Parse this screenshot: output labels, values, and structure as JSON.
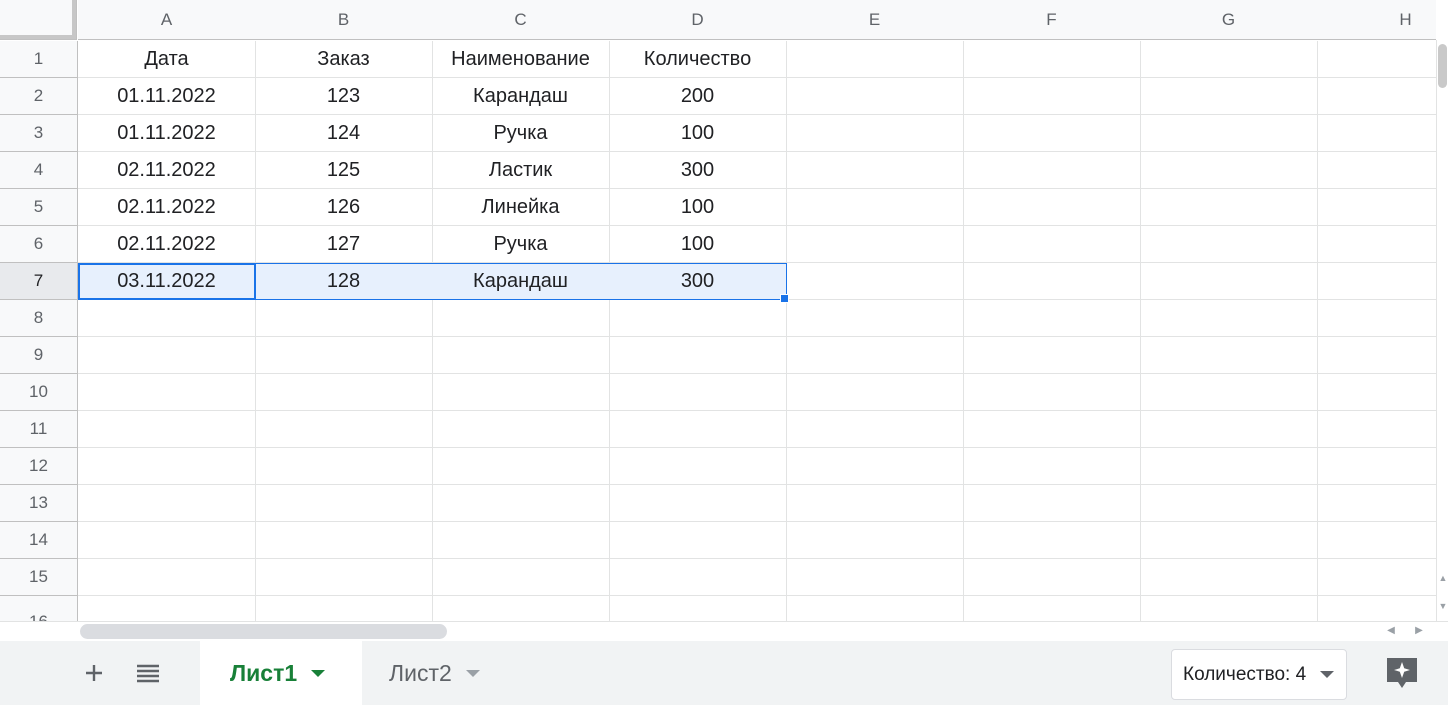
{
  "columns": [
    "A",
    "B",
    "C",
    "D",
    "E",
    "F",
    "G",
    "H"
  ],
  "rows": [
    "1",
    "2",
    "3",
    "4",
    "5",
    "6",
    "7",
    "8",
    "9",
    "10",
    "11",
    "12",
    "13",
    "14",
    "15",
    "16"
  ],
  "cells": [
    [
      "Дата",
      "Заказ",
      "Наименование",
      "Количество"
    ],
    [
      "01.11.2022",
      "123",
      "Карандаш",
      "200"
    ],
    [
      "01.11.2022",
      "124",
      "Ручка",
      "100"
    ],
    [
      "02.11.2022",
      "125",
      "Ластик",
      "300"
    ],
    [
      "02.11.2022",
      "126",
      "Линейка",
      "100"
    ],
    [
      "02.11.2022",
      "127",
      "Ручка",
      "100"
    ],
    [
      "03.11.2022",
      "128",
      "Карандаш",
      "300"
    ]
  ],
  "selection": {
    "active_cell": "A7",
    "range": "A7:D7"
  },
  "sheets": [
    {
      "label": "Лист1",
      "active": true
    },
    {
      "label": "Лист2",
      "active": false
    }
  ],
  "status": {
    "summary_label": "Количество: 4"
  },
  "icons": {
    "add_sheet": "plus-icon",
    "all_sheets": "list-icon",
    "explore": "explore-icon"
  },
  "colors": {
    "accent": "#1a73e8",
    "active_tab": "#188038",
    "selection_fill": "#e7f0fd"
  }
}
